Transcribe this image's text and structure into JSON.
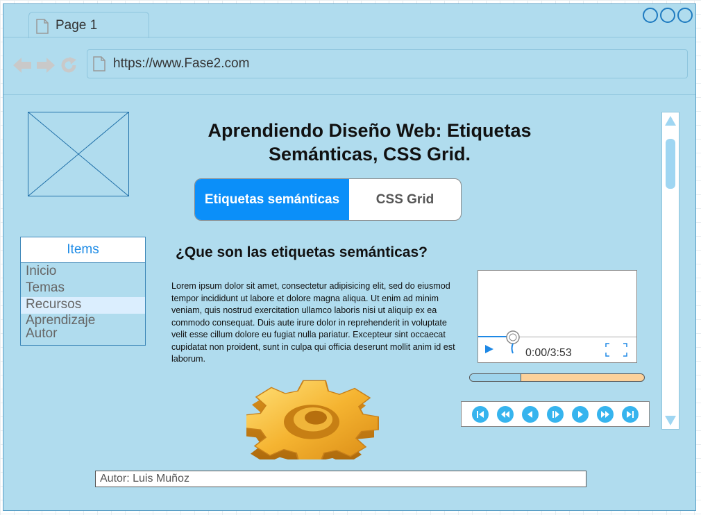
{
  "browser": {
    "tab_title": "Page 1",
    "url": "https://www.Fase2.com"
  },
  "page": {
    "title": "Aprendiendo Diseño Web: Etiquetas Semánticas, CSS Grid.",
    "tabs": [
      {
        "label": "Etiquetas semánticas",
        "active": true
      },
      {
        "label": "CSS Grid",
        "active": false
      }
    ],
    "section_title": "¿Que son las etiquetas semánticas?",
    "body_text": "Lorem ipsum dolor sit amet, consectetur adipisicing elit, sed do eiusmod tempor incididunt ut labore et dolore magna aliqua. Ut enim ad minim veniam, quis nostrud exercitation ullamco laboris nisi ut aliquip ex ea commodo consequat. Duis aute irure dolor in reprehenderit in voluptate velit esse cillum dolore eu fugiat nulla pariatur. Excepteur sint occaecat cupidatat non proident, sunt in culpa qui officia deserunt mollit anim id est laborum.",
    "author": "Autor: Luis Muñoz"
  },
  "items_panel": {
    "header": "Items",
    "items": [
      "Inicio",
      "Temas",
      "Recursos",
      "Aprendizaje",
      "Autor"
    ],
    "selected_index": 2
  },
  "video": {
    "time": "0:00/3:53",
    "progress_fraction": 0
  },
  "slider": {
    "value_fraction": 0.29
  },
  "media_controls": [
    "skip-to-start-icon",
    "rewind-icon",
    "previous-icon",
    "pause-icon",
    "play-icon",
    "fast-forward-icon",
    "skip-to-end-icon"
  ],
  "colors": {
    "window_bg": "#b0dcee",
    "accent": "#0b8ff9",
    "slider_track": "#fbd19b"
  }
}
